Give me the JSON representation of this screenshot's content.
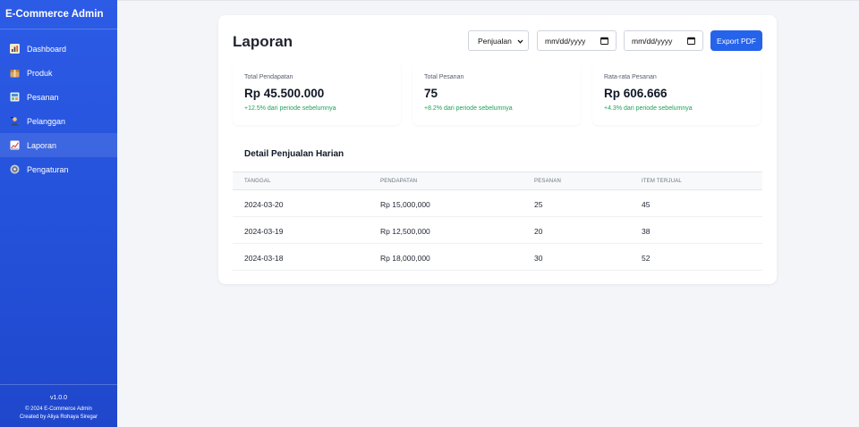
{
  "app": {
    "title": "E-Commerce Admin"
  },
  "sidebar": {
    "items": [
      {
        "label": "Dashboard",
        "icon": "chart-icon",
        "active": false
      },
      {
        "label": "Produk",
        "icon": "package-icon",
        "active": false
      },
      {
        "label": "Pesanan",
        "icon": "cart-icon",
        "active": false
      },
      {
        "label": "Pelanggan",
        "icon": "users-icon",
        "active": false
      },
      {
        "label": "Laporan",
        "icon": "report-icon",
        "active": true
      },
      {
        "label": "Pengaturan",
        "icon": "gear-icon",
        "active": false
      }
    ],
    "version": "v1.0.0",
    "copyright": "© 2024 E-Commerce Admin",
    "credit": "Created by Aliya Rohaya Siregar"
  },
  "header": {
    "title": "Laporan",
    "report_type": "Penjualan",
    "start_date": "mm/dd/yyyy",
    "end_date": "mm/dd/yyyy",
    "export_label": "Export PDF"
  },
  "stats": [
    {
      "label": "Total Pendapatan",
      "value": "Rp 45.500.000",
      "change": "+12.5% dari periode sebelumnya"
    },
    {
      "label": "Total Pesanan",
      "value": "75",
      "change": "+8.2% dari periode sebelumnya"
    },
    {
      "label": "Rata-rata Pesanan",
      "value": "Rp 606.666",
      "change": "+4.3% dari periode sebelumnya"
    }
  ],
  "details": {
    "title": "Detail Penjualan Harian",
    "columns": [
      "Tanggal",
      "Pendapatan",
      "Pesanan",
      "Item Terjual"
    ],
    "rows": [
      [
        "2024-03-20",
        "Rp 15,000,000",
        "25",
        "45"
      ],
      [
        "2024-03-19",
        "Rp 12,500,000",
        "20",
        "38"
      ],
      [
        "2024-03-18",
        "Rp 18,000,000",
        "30",
        "52"
      ]
    ]
  },
  "colors": {
    "accent": "#2563eb",
    "positive": "#21a05a",
    "sidebar": "#2451d9"
  }
}
